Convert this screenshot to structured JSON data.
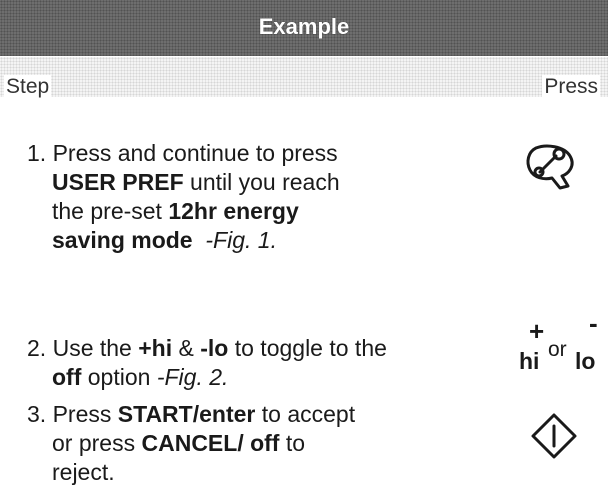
{
  "title": "Example",
  "header": {
    "step": "Step",
    "press": "Press"
  },
  "steps": [
    {
      "num": "1.",
      "t1": "Press and continue to press",
      "b1": "USER PREF",
      "t2": " until you reach",
      "t3": "the pre-set ",
      "b2": "12hr energy",
      "b3": "saving mode",
      "fig": "-Fig. 1."
    },
    {
      "num": "2.",
      "t1": "Use the ",
      "b1": "+hi",
      "t2": " & ",
      "b2": "-lo",
      "t3": " to toggle to the",
      "b3": "off",
      "t4": " option ",
      "fig": "-Fig. 2."
    },
    {
      "num": "3.",
      "t1": "Press ",
      "b1": "START/enter",
      "t2": " to accept",
      "t3": "or press ",
      "b2": "CANCEL/ off",
      "t4": " to",
      "t5": "reject."
    }
  ],
  "press_icons": {
    "step1_icon": "wrench-gear-icon",
    "step2": {
      "plus": "+",
      "minus": "-",
      "hi": "hi",
      "or": "or",
      "lo": "lo"
    },
    "step3_icon": "start-diamond-icon"
  }
}
